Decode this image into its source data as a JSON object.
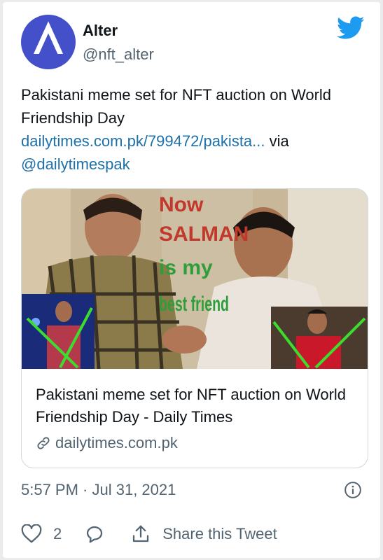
{
  "author": {
    "name": "Alter",
    "handle": "@nft_alter"
  },
  "tweet": {
    "text": "Pakistani meme set for NFT auction on World Friendship Day",
    "link_text": "dailytimes.com.pk/799472/pakista...",
    "via_text": " via ",
    "mention": "@dailytimespak"
  },
  "media": {
    "caption_lines": [
      "Now",
      "SALMAN",
      "is my",
      "best friend"
    ]
  },
  "link_card": {
    "title": "Pakistani meme set for NFT auction on World Friendship Day - Daily Times",
    "domain": "dailytimes.com.pk"
  },
  "timestamp": "5:57 PM · Jul 31, 2021",
  "actions": {
    "like_count": "2",
    "share_label": "Share this Tweet"
  },
  "colors": {
    "avatar": "#4450c9",
    "twitter_blue": "#1d9bf0",
    "link": "#1d70a8",
    "caption_red": "#c0392b",
    "caption_green": "#2e9e3a"
  },
  "icons": [
    "twitter-bird-icon",
    "link-icon",
    "info-icon",
    "heart-icon",
    "reply-icon",
    "share-icon"
  ]
}
